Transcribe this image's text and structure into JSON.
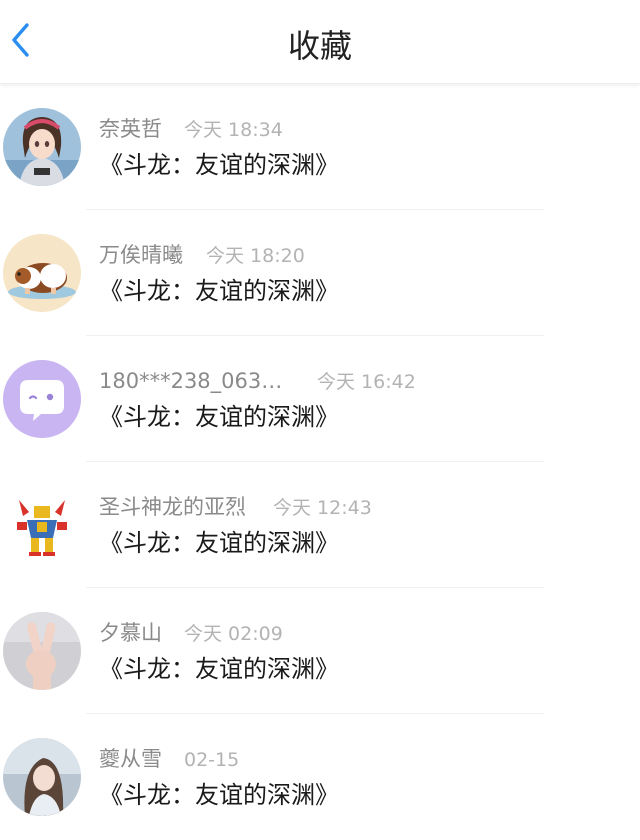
{
  "header": {
    "title": "收藏",
    "back_icon": "chevron-left-icon",
    "accent_color": "#2a8ef0"
  },
  "items": [
    {
      "name": "奈英哲",
      "time": "今天 18:34",
      "content": "《斗龙：友谊的深渊》",
      "avatar": "anime-girl-avatar"
    },
    {
      "name": "万俟晴曦",
      "time": "今天 18:20",
      "content": "《斗龙：友谊的深渊》",
      "avatar": "guinea-pig-avatar"
    },
    {
      "name": "180***238_063…",
      "time": "今天 16:42",
      "content": "《斗龙：友谊的深渊》",
      "avatar": "chat-bubble-avatar"
    },
    {
      "name": "圣斗神龙的亚烈",
      "time": "今天 12:43",
      "content": "《斗龙：友谊的深渊》",
      "avatar": "robot-dragon-avatar"
    },
    {
      "name": "夕慕山",
      "time": "今天 02:09",
      "content": "《斗龙：友谊的深渊》",
      "avatar": "peace-hand-avatar"
    },
    {
      "name": "夔从雪",
      "time": "02-15",
      "content": "《斗龙：友谊的深渊》",
      "avatar": "girl-photo-avatar"
    }
  ]
}
